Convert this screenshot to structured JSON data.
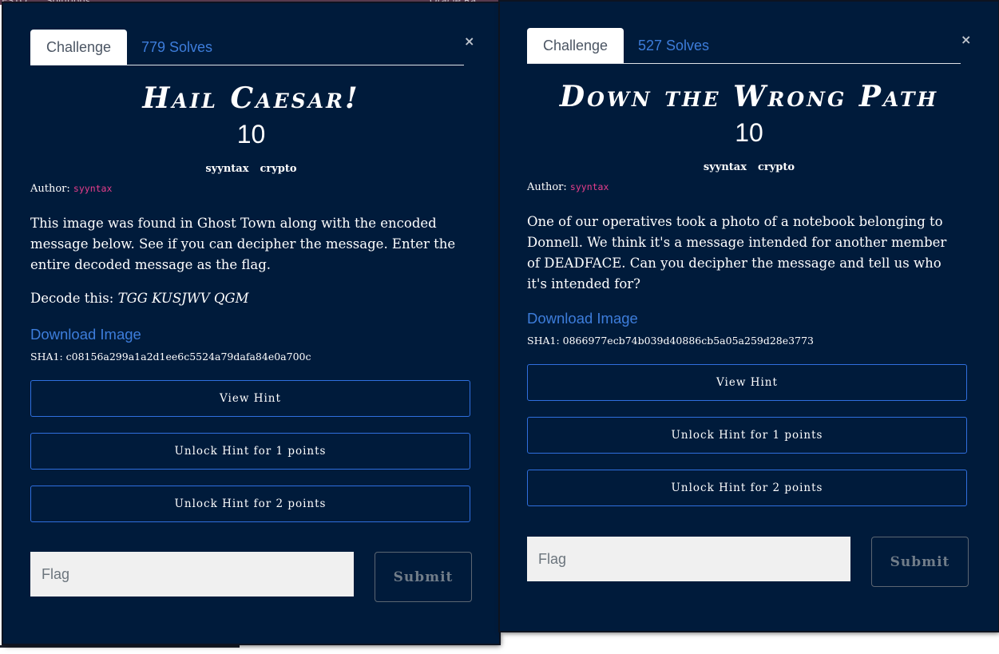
{
  "background_strip": {
    "left_text": "ESTO",
    "left_text2": "Solutions",
    "right_text": "Oracle Ra"
  },
  "colors": {
    "modal_bg": "#001b3b",
    "link": "#3d7ddb",
    "author_name": "#e83e8c",
    "hint_border": "#2f6fde"
  },
  "modals": [
    {
      "tab_challenge": "Challenge",
      "tab_solves": "779 Solves",
      "close_icon": "×",
      "title": "Hail Caesar!",
      "points": "10",
      "tags": [
        "syyntax",
        "crypto"
      ],
      "author_label": "Author:",
      "author_name": "syyntax",
      "description": "This image was found in Ghost Town along with the encoded message below. See if you can decipher the message. Enter the entire decoded message as the flag.",
      "decode_label": "Decode this:",
      "decode_value": "TGG KUSJWV QGM",
      "download_label": "Download Image",
      "sha": "SHA1: c08156a299a1a2d1ee6c5524a79dafa84e0a700c",
      "hints": [
        "View Hint",
        "Unlock Hint for 1 points",
        "Unlock Hint for 2 points"
      ],
      "flag_placeholder": "Flag",
      "submit_label": "Submit"
    },
    {
      "tab_challenge": "Challenge",
      "tab_solves": "527 Solves",
      "close_icon": "×",
      "title": "Down the Wrong Path",
      "points": "10",
      "tags": [
        "syyntax",
        "crypto"
      ],
      "author_label": "Author:",
      "author_name": "syyntax",
      "description": "One of our operatives took a photo of a notebook belonging to Donnell. We think it's a message intended for another member of DEADFACE. Can you decipher the message and tell us who it's intended for?",
      "download_label": "Download Image",
      "sha": "SHA1: 0866977ecb74b039d40886cb5a05a259d28e3773",
      "hints": [
        "View Hint",
        "Unlock Hint for 1 points",
        "Unlock Hint for 2 points"
      ],
      "flag_placeholder": "Flag",
      "submit_label": "Submit"
    }
  ]
}
